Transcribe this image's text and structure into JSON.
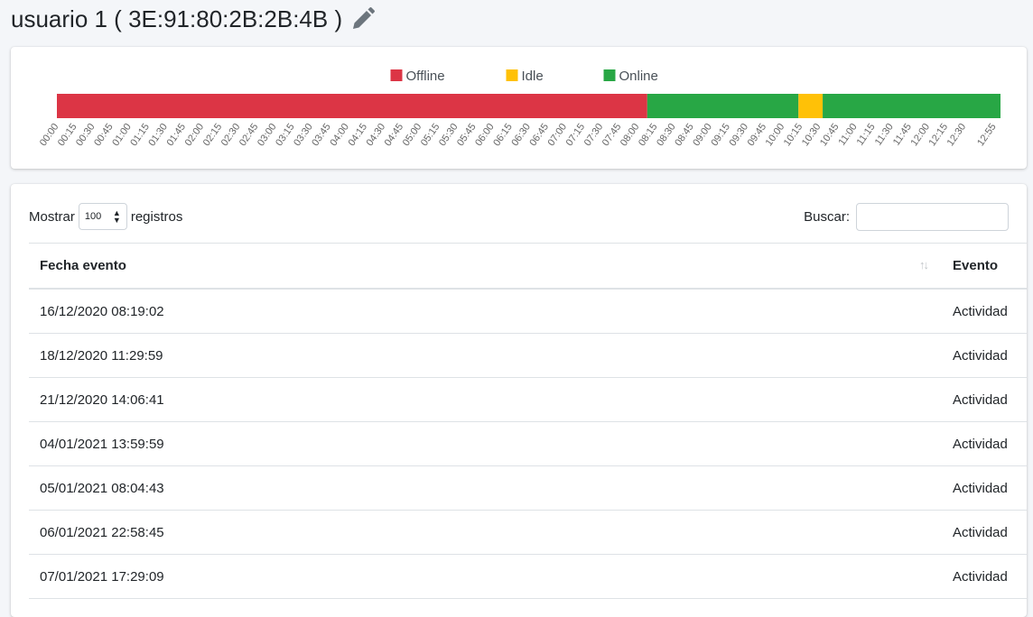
{
  "header": {
    "title": "usuario 1 ( 3E:91:80:2B:2B:4B )",
    "edit_icon": "pencil-icon"
  },
  "chart_data": {
    "type": "timeline",
    "legend": [
      {
        "label": "Offline",
        "color": "#dc3545"
      },
      {
        "label": "Idle",
        "color": "#ffc107"
      },
      {
        "label": "Online",
        "color": "#28a745"
      }
    ],
    "segments": [
      {
        "state": "Offline",
        "start": "00:00",
        "end": "08:08"
      },
      {
        "state": "Online",
        "start": "08:08",
        "end": "10:13"
      },
      {
        "state": "Idle",
        "start": "10:13",
        "end": "10:33"
      },
      {
        "state": "Online",
        "start": "10:33",
        "end": "13:00"
      }
    ],
    "x_ticks": [
      "00:00",
      "00:15",
      "00:30",
      "00:45",
      "01:00",
      "01:15",
      "01:30",
      "01:45",
      "02:00",
      "02:15",
      "02:30",
      "02:45",
      "03:00",
      "03:15",
      "03:30",
      "03:45",
      "04:00",
      "04:15",
      "04:30",
      "04:45",
      "05:00",
      "05:15",
      "05:30",
      "05:45",
      "06:00",
      "06:15",
      "06:30",
      "06:45",
      "07:00",
      "07:15",
      "07:30",
      "07:45",
      "08:00",
      "08:15",
      "08:30",
      "08:45",
      "09:00",
      "09:15",
      "09:30",
      "09:45",
      "10:00",
      "10:15",
      "10:30",
      "10:45",
      "11:00",
      "11:15",
      "11:30",
      "11:45",
      "12:00",
      "12:15",
      "12:30",
      "12:55"
    ],
    "x_range": [
      "00:00",
      "13:00"
    ]
  },
  "table_controls": {
    "show_label": "Mostrar",
    "page_size": "100",
    "records_label": "registros",
    "search_label": "Buscar:",
    "search_value": ""
  },
  "table": {
    "columns": [
      "Fecha evento",
      "Evento"
    ],
    "rows": [
      [
        "16/12/2020 08:19:02",
        "Actividad"
      ],
      [
        "18/12/2020 11:29:59",
        "Actividad"
      ],
      [
        "21/12/2020 14:06:41",
        "Actividad"
      ],
      [
        "04/01/2021 13:59:59",
        "Actividad"
      ],
      [
        "05/01/2021 08:04:43",
        "Actividad"
      ],
      [
        "06/01/2021 22:58:45",
        "Actividad"
      ],
      [
        "07/01/2021 17:29:09",
        "Actividad"
      ]
    ]
  }
}
